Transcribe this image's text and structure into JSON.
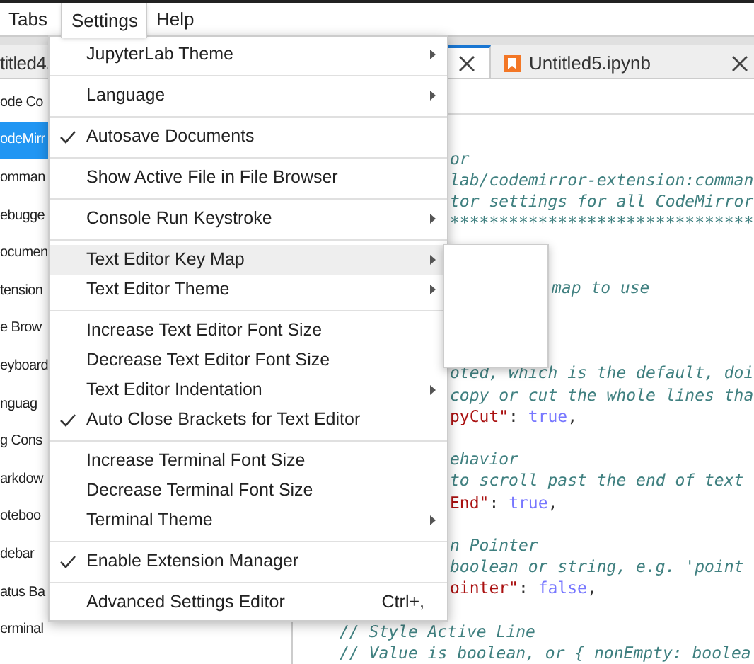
{
  "menubar": [
    {
      "label": "Tabs",
      "selected": false
    },
    {
      "label": "Settings",
      "selected": true
    },
    {
      "label": "Help",
      "selected": false
    }
  ],
  "tabs": [
    {
      "label": "titled4.",
      "selected": false,
      "kind": "plain"
    },
    {
      "selected": true,
      "kind": "closeonly"
    },
    {
      "label": "Untitled5.ipynb",
      "selected": false,
      "kind": "notebook"
    }
  ],
  "sidebar": {
    "items": [
      {
        "label": "ode Co",
        "selected": false
      },
      {
        "label": "odeMirr",
        "selected": true
      },
      {
        "label": "omman",
        "selected": false
      },
      {
        "label": "ebugge",
        "selected": false
      },
      {
        "label": "ocumen",
        "selected": false
      },
      {
        "label": "tension",
        "selected": false
      },
      {
        "label": "e Brow",
        "selected": false
      },
      {
        "label": "eyboard",
        "selected": false
      },
      {
        "label": "nguag",
        "selected": false
      },
      {
        "label": "g Cons",
        "selected": false
      },
      {
        "label": "arkdow",
        "selected": false
      },
      {
        "label": "oteboo",
        "selected": false
      },
      {
        "label": "debar",
        "selected": false
      },
      {
        "label": "atus Ba",
        "selected": false
      },
      {
        "label": "erminal",
        "selected": false
      }
    ]
  },
  "editor": {
    "lines": [
      {
        "kind": "blank"
      },
      {
        "kind": "cut",
        "tokens": [
          {
            "kind": "comment",
            "text": "or"
          }
        ]
      },
      {
        "kind": "cut",
        "tokens": [
          {
            "kind": "comment",
            "text": "lab/codemirror-extension:comman"
          }
        ]
      },
      {
        "kind": "cut",
        "tokens": [
          {
            "kind": "comment",
            "text": "tor settings for all CodeMirror"
          }
        ]
      },
      {
        "kind": "cut",
        "tokens": [
          {
            "kind": "comment",
            "text": "*******************************"
          }
        ]
      },
      {
        "kind": "blank"
      },
      {
        "kind": "blank"
      },
      {
        "kind": "cut_submenu",
        "tokens": [
          {
            "kind": "comment",
            "text": "map to use"
          }
        ]
      },
      {
        "kind": "blank"
      },
      {
        "kind": "blank"
      },
      {
        "kind": "blank"
      },
      {
        "kind": "cut",
        "tokens": [
          {
            "kind": "comment",
            "text": "oted, which is the default, doi"
          }
        ]
      },
      {
        "kind": "cut",
        "tokens": [
          {
            "kind": "comment",
            "text": "copy or cut the whole lines tha"
          }
        ]
      },
      {
        "kind": "cut",
        "tokens": [
          {
            "kind": "key",
            "text": "pyCut\""
          },
          {
            "kind": "punct",
            "text": ": "
          },
          {
            "kind": "atom",
            "text": "true"
          },
          {
            "kind": "punct",
            "text": ","
          }
        ]
      },
      {
        "kind": "blank"
      },
      {
        "kind": "cut",
        "tokens": [
          {
            "kind": "comment",
            "text": "ehavior"
          }
        ]
      },
      {
        "kind": "cut",
        "tokens": [
          {
            "kind": "comment",
            "text": "to scroll past the end of text"
          }
        ]
      },
      {
        "kind": "cut",
        "tokens": [
          {
            "kind": "key",
            "text": "End\""
          },
          {
            "kind": "punct",
            "text": ": "
          },
          {
            "kind": "atom",
            "text": "true"
          },
          {
            "kind": "punct",
            "text": ","
          }
        ]
      },
      {
        "kind": "blank"
      },
      {
        "kind": "cut",
        "tokens": [
          {
            "kind": "comment",
            "text": "n Pointer"
          }
        ]
      },
      {
        "kind": "cut",
        "tokens": [
          {
            "kind": "comment",
            "text": "boolean or string, e.g. 'point"
          }
        ]
      },
      {
        "kind": "cut",
        "tokens": [
          {
            "kind": "key",
            "text": "ointer\""
          },
          {
            "kind": "punct",
            "text": ": "
          },
          {
            "kind": "atom",
            "text": "false"
          },
          {
            "kind": "punct",
            "text": ","
          }
        ]
      },
      {
        "kind": "blank"
      },
      {
        "kind": "full",
        "tokens": [
          {
            "kind": "comment",
            "text": "// Style Active Line"
          }
        ]
      },
      {
        "kind": "full",
        "tokens": [
          {
            "kind": "comment",
            "text": "// Value is boolean, or { nonEmpty: boolea"
          }
        ]
      }
    ]
  },
  "settings_menu": {
    "groups": [
      [
        {
          "label": "JupyterLab Theme",
          "checked": false,
          "submenu": true,
          "selected": false
        }
      ],
      [
        {
          "label": "Language",
          "checked": false,
          "submenu": true,
          "selected": false
        }
      ],
      [
        {
          "label": "Autosave Documents",
          "checked": true,
          "submenu": false,
          "selected": false
        }
      ],
      [
        {
          "label": "Show Active File in File Browser",
          "checked": false,
          "submenu": false,
          "selected": false
        }
      ],
      [
        {
          "label": "Console Run Keystroke",
          "checked": false,
          "submenu": true,
          "selected": false
        }
      ],
      [
        {
          "label": "Text Editor Key Map",
          "checked": false,
          "submenu": true,
          "selected": true
        },
        {
          "label": "Text Editor Theme",
          "checked": false,
          "submenu": true,
          "selected": false
        }
      ],
      [
        {
          "label": "Increase Text Editor Font Size",
          "checked": false,
          "submenu": false,
          "selected": false
        },
        {
          "label": "Decrease Text Editor Font Size",
          "checked": false,
          "submenu": false,
          "selected": false
        },
        {
          "label": "Text Editor Indentation",
          "checked": false,
          "submenu": true,
          "selected": false
        },
        {
          "label": "Auto Close Brackets for Text Editor",
          "checked": true,
          "submenu": false,
          "selected": false
        }
      ],
      [
        {
          "label": "Increase Terminal Font Size",
          "checked": false,
          "submenu": false,
          "selected": false
        },
        {
          "label": "Decrease Terminal Font Size",
          "checked": false,
          "submenu": false,
          "selected": false
        },
        {
          "label": "Terminal Theme",
          "checked": false,
          "submenu": true,
          "selected": false
        }
      ],
      [
        {
          "label": "Enable Extension Manager",
          "checked": true,
          "submenu": false,
          "selected": false
        }
      ],
      [
        {
          "label": "Advanced Settings Editor",
          "checked": false,
          "submenu": false,
          "selected": false,
          "shortcut": "Ctrl+,"
        }
      ]
    ]
  }
}
